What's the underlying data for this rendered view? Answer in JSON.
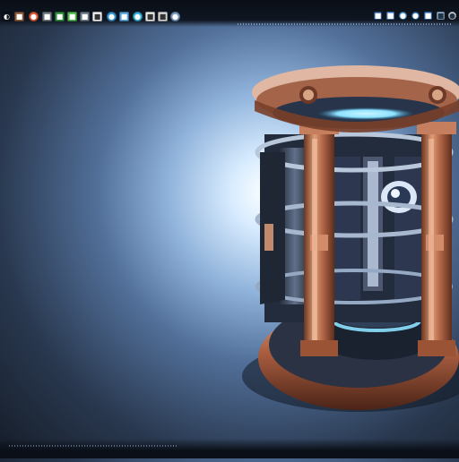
{
  "toolbar": {
    "left_icons": [
      {
        "name": "app-icon",
        "glyph": "◐",
        "color": "#ffffff"
      },
      {
        "name": "folder-icon",
        "glyph": "■",
        "color": "#8b5a3b"
      },
      {
        "name": "record-icon",
        "glyph": "●",
        "color": "#e25b3a"
      },
      {
        "name": "settings-icon",
        "glyph": "■",
        "color": "#6e7780"
      },
      {
        "name": "green-app-icon",
        "glyph": "■",
        "color": "#2f8d3c"
      },
      {
        "name": "chart-icon",
        "glyph": "■",
        "color": "#50b94d"
      },
      {
        "name": "image-icon",
        "glyph": "■",
        "color": "#6d7a88"
      },
      {
        "name": "tool-icon",
        "glyph": "■",
        "color": "#f2f2f2"
      },
      {
        "name": "browser-icon",
        "glyph": "●",
        "color": "#3a9ad9"
      },
      {
        "name": "mail-icon",
        "glyph": "■",
        "color": "#56a3dc"
      },
      {
        "name": "chat-icon",
        "glyph": "●",
        "color": "#3bb7e2"
      },
      {
        "name": "notes-icon",
        "glyph": "■",
        "color": "#e8e8e8"
      },
      {
        "name": "music-icon",
        "glyph": "■",
        "color": "#d7d7d7"
      },
      {
        "name": "profile-icon",
        "glyph": "●",
        "color": "#7f9dc8"
      }
    ],
    "right_icons": [
      {
        "name": "window-icon",
        "glyph": "■",
        "color": "#3a74b8"
      },
      {
        "name": "calendar-icon",
        "glyph": "■",
        "color": "#65a2e3"
      },
      {
        "name": "sync-icon",
        "glyph": "●",
        "color": "#55a9e8"
      },
      {
        "name": "cloud-icon",
        "glyph": "●",
        "color": "#3b84c8"
      },
      {
        "name": "network-icon",
        "glyph": "■",
        "color": "#4f8cd2"
      },
      {
        "name": "volume-icon",
        "glyph": "■",
        "color": "#a9c8ef"
      },
      {
        "name": "clock-icon",
        "glyph": "●",
        "color": "#e3edf8"
      }
    ]
  },
  "wallpaper": {
    "subject": "teleporter-chamber",
    "colors": {
      "copper": "#b56a4a",
      "copper_light": "#e6a37c",
      "steel": "#3b4658",
      "glow": "#8de1ff"
    }
  }
}
